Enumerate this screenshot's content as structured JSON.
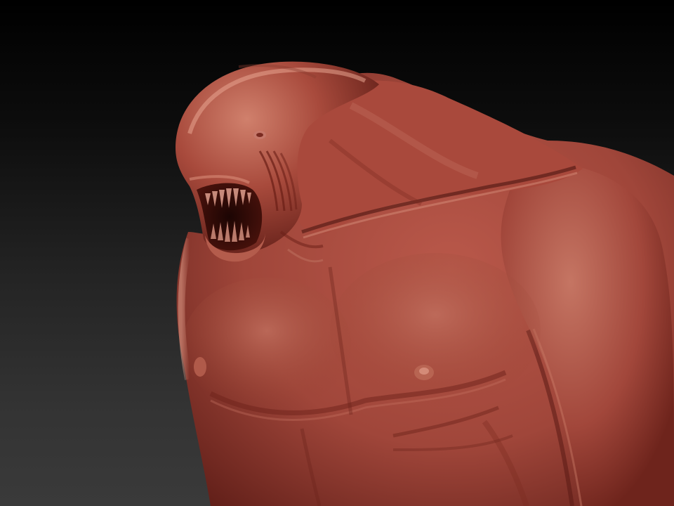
{
  "scene": {
    "subject": "sculpted-creature-torso",
    "background_gradient": [
      "#000000",
      "#3a3a3a"
    ],
    "material_colors": {
      "base": "#a8483c",
      "highlight": "#d98a76",
      "shadow": "#4a1612",
      "mouth": "#2a0806",
      "teeth": "#c7897a"
    }
  }
}
